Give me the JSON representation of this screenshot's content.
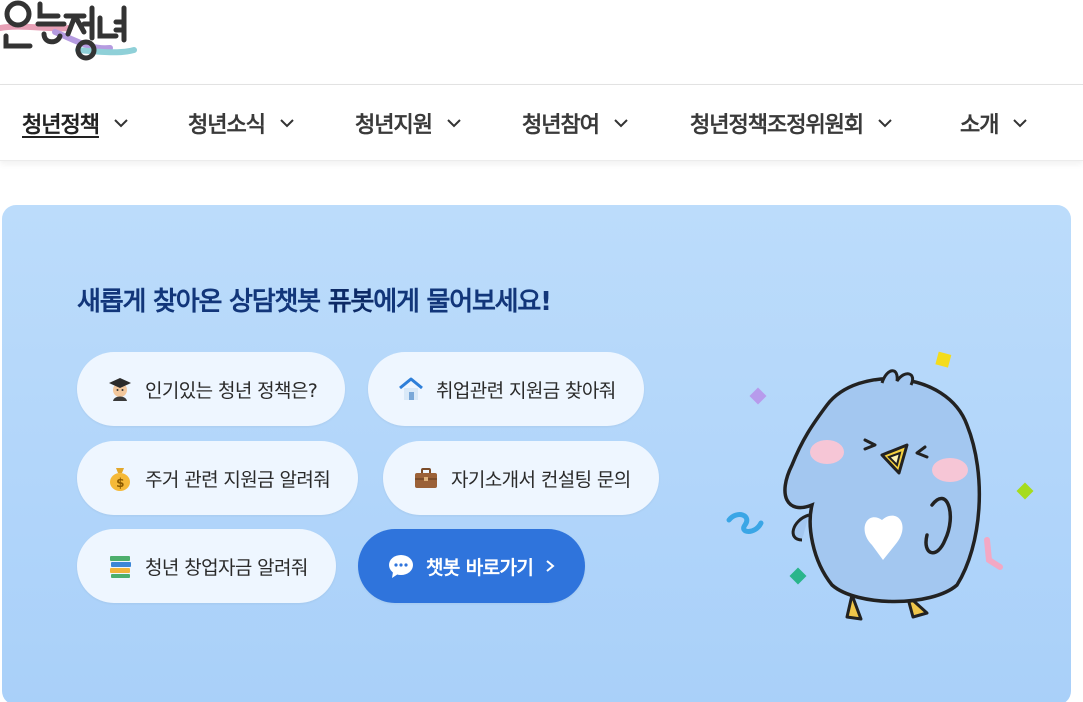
{
  "header": {
    "logo_text": "온통청년"
  },
  "nav": {
    "items": [
      {
        "label": "청년정책"
      },
      {
        "label": "청년소식"
      },
      {
        "label": "청년지원"
      },
      {
        "label": "청년참여"
      },
      {
        "label": "청년정책조정위원회"
      },
      {
        "label": "소개"
      }
    ]
  },
  "hero": {
    "title_pre": "새롭게 찾아온 상담챗봇 ",
    "title_highlight": "퓨봇",
    "title_post": "에게 물어보세요!",
    "chips": [
      {
        "label": "인기있는 청년 정책은?",
        "icon": "graduate-icon"
      },
      {
        "label": "취업관련 지원금 찾아줘",
        "icon": "house-icon"
      },
      {
        "label": "주거 관련 지원금 알려줘",
        "icon": "money-bag-icon"
      },
      {
        "label": "자기소개서 컨설팅 문의",
        "icon": "briefcase-icon"
      },
      {
        "label": "청년 창업자금 알려줘",
        "icon": "books-icon"
      }
    ],
    "chatbot_button": "챗봇 바로가기",
    "colors": {
      "primary": "#2f74dc",
      "title": "#12367a",
      "chip_bg": "#eef6ff"
    }
  }
}
